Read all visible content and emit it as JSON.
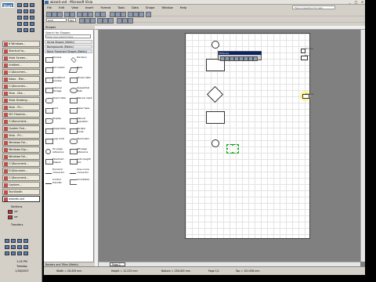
{
  "taskbar": {
    "start_label": "Start",
    "buttons": [
      "6 Windows...",
      "Shortcut to...",
      "Vista Screen...",
      "Untitled...",
      "C:\\Documen...",
      "Inbox - Micr...",
      "C:\\Documen...",
      "Visio - Dra...",
      "Vista Drawing...",
      "Visio - Pri...",
      "ISO Flowcha...",
      "C:\\Document...",
      "Quotes Ove...",
      "Visio - Pri...",
      "Windows Fol...",
      "Windows Exp...",
      "Windows Fol...",
      "C:\\Document...",
      "D:\\Documen...",
      "C:\\Document...",
      "Capture...",
      "TechSmith",
      "Visio - Pri...",
      "Tasks",
      "wizards.vsd"
    ],
    "active_index": 24,
    "tray": {
      "label_1": "Sections",
      "item_1": "Off",
      "item_2": "Off",
      "label_2": "Transfers"
    },
    "clock": {
      "time": "1:25 PM",
      "day": "Tuesday",
      "date": "1/30/2007"
    }
  },
  "window": {
    "title": "wizard.vsd - Microsoft Visio",
    "controls": {
      "minimize": "_",
      "maximize": "□",
      "close": "×"
    },
    "menu": [
      "File",
      "Edit",
      "View",
      "Insert",
      "Format",
      "Tools",
      "Data",
      "Shape",
      "Window",
      "Help"
    ],
    "help_placeholder": "Type a question for help"
  },
  "toolbar": {
    "font": "Arial",
    "size": "8pt"
  },
  "shapes_pane": {
    "title": "Shapes",
    "search_label": "Search for Shapes:",
    "search_placeholder": "Type your search here",
    "stencils": [
      "Arrow Shapes (Metric)",
      "Backgrounds (Metric)",
      "Basic Flowchart Shapes (Metric)"
    ],
    "items": [
      "Process",
      "Decision",
      "Document",
      "Data",
      "Predefined process",
      "Stored data",
      "Internal storage",
      "Sequential data",
      "Direct data",
      "Manual input",
      "Card",
      "Paper tape",
      "Display",
      "Manual operation",
      "Preparation",
      "Parallel mode",
      "Loop limit",
      "Terminator",
      "On-page reference",
      "Off-page reference",
      "Flowchart shapes",
      "Auto-height box",
      "Dynamic connector",
      "Line-curve connector",
      "Control transfer",
      "Annotation"
    ],
    "bottom_tab": "Borders and Titles (Metric)"
  },
  "canvas": {
    "page_tab": "Page-1",
    "legend": [
      "Process",
      "Start",
      "Decision"
    ],
    "floating_toolbar_title": "Pictures"
  },
  "statusbar": {
    "width": "Width = 26.459 mm",
    "height": "Height = 12.225 mm",
    "bottom": "Bottom = 138.000 mm",
    "page": "Page 1/1",
    "top": "Top = 151.938 mm"
  }
}
